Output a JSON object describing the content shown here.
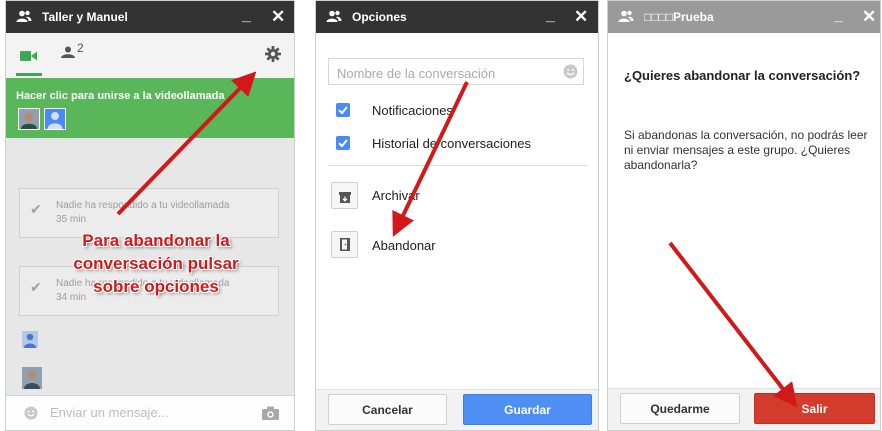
{
  "panel1": {
    "title": "Taller y Manuel",
    "minimize": "_",
    "close": "✕",
    "tab_people_count": "2",
    "join_text": "Hacer clic para unirse a la videollamada",
    "notices": [
      {
        "text": "Nadie ha respondido a tu videollamada",
        "time": "35 min"
      },
      {
        "text": "Nadie ha respondido a tu videollamada",
        "time": "34 min"
      }
    ],
    "composer_placeholder": "Enviar un mensaje...",
    "caption_lines": [
      "Para abandonar  la",
      "conversación pulsar",
      "sobre opciones"
    ]
  },
  "panel2": {
    "title": "Opciones",
    "minimize": "_",
    "close": "✕",
    "search_placeholder": "Nombre de la conversación",
    "options": [
      {
        "label": "Notificaciones",
        "checked": true
      },
      {
        "label": "Historial de conversaciones",
        "checked": true
      }
    ],
    "archive_label": "Archivar",
    "leave_label": "Abandonar",
    "cancel_label": "Cancelar",
    "save_label": "Guardar"
  },
  "panel3": {
    "title": "□□□□Prueba",
    "minimize": "_",
    "close": "✕",
    "question": "¿Quieres abandonar la conversación?",
    "body": "Si abandonas la conversación, no podrás leer ni enviar mensajes a este grupo. ¿Quieres abandonarla?",
    "stay_label": "Quedarme",
    "exit_label": "Salir"
  },
  "colors": {
    "titlebar_dark": "#333333",
    "titlebar_gray": "#9a9a9a",
    "join_green": "#59b75a",
    "checkbox_blue": "#4a8af4",
    "save_blue": "#4f8ef2",
    "exit_red": "#d33b2c",
    "annotation_red": "#d11919"
  },
  "icons": [
    "people-icon",
    "video-camera-icon",
    "gear-icon",
    "smiley-icon",
    "camera-icon",
    "archive-icon",
    "exit-door-icon",
    "check-icon"
  ]
}
